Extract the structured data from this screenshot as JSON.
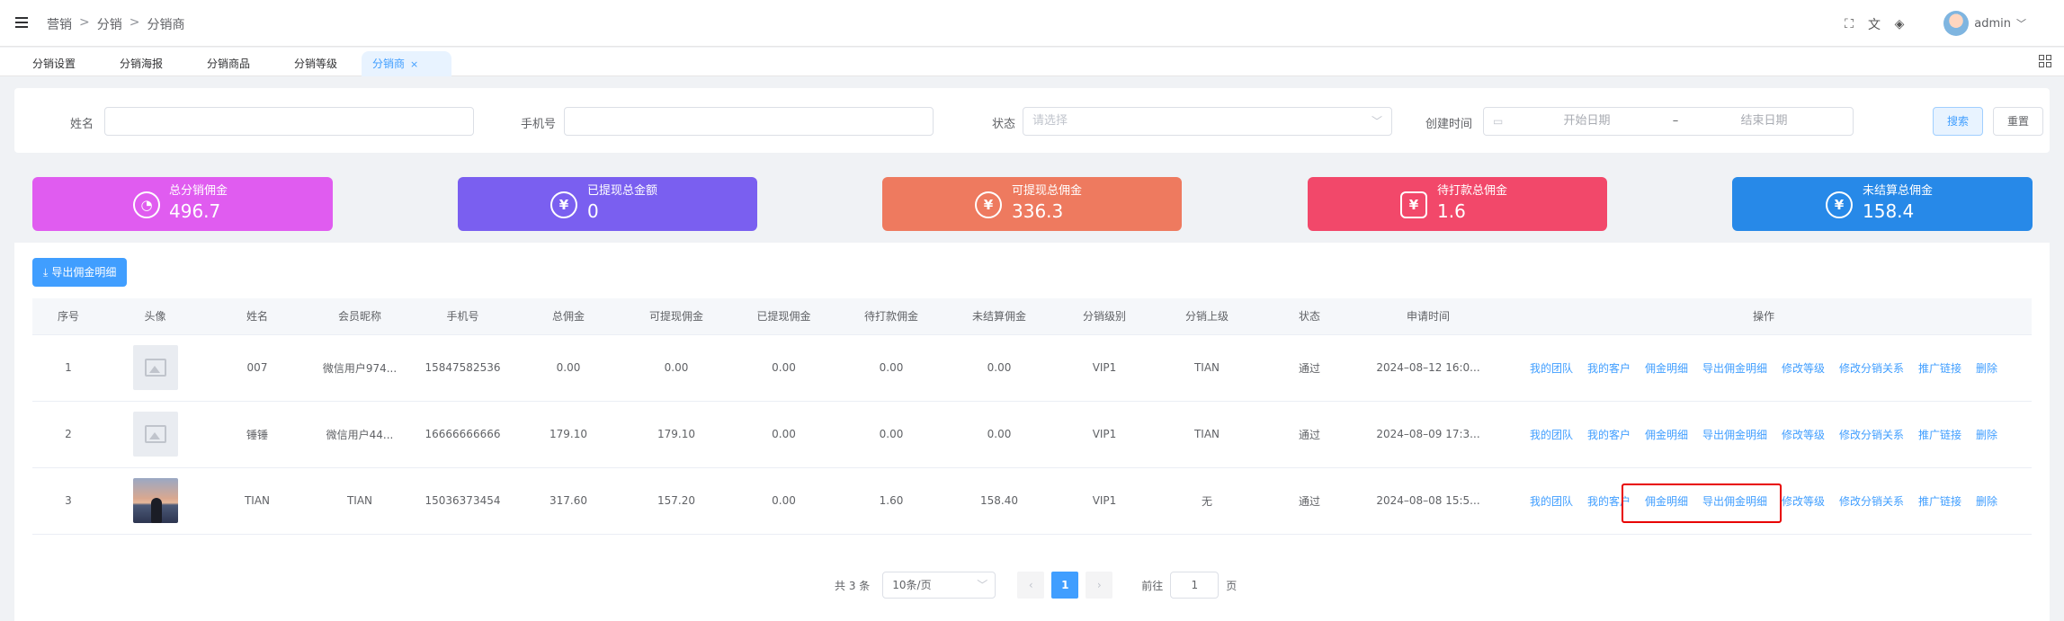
{
  "breadcrumb": {
    "items": [
      "营销",
      "分销",
      "分销商"
    ],
    "sep": ">"
  },
  "header": {
    "username": "admin"
  },
  "tabs": [
    {
      "label": "分销设置"
    },
    {
      "label": "分销海报"
    },
    {
      "label": "分销商品"
    },
    {
      "label": "分销等级"
    },
    {
      "label": "分销商",
      "active": true,
      "close": "×"
    }
  ],
  "search": {
    "name_label": "姓名",
    "name_value": "",
    "phone_label": "手机号",
    "phone_value": "",
    "status_label": "状态",
    "status_placeholder": "请选择",
    "created_label": "创建时间",
    "start_placeholder": "开始日期",
    "range_sep": "–",
    "end_placeholder": "结束日期",
    "search_button": "搜索",
    "reset_button": "重置"
  },
  "stats": [
    {
      "title": "总分销佣金",
      "value": "496.7",
      "color": "#e05cf0",
      "icon": "pie-chart-icon",
      "glyph": "◔"
    },
    {
      "title": "已提现总金额",
      "value": "0",
      "color": "#7a5ff0",
      "icon": "yen-icon",
      "glyph": "¥"
    },
    {
      "title": "可提现总佣金",
      "value": "336.3",
      "color": "#ee7a5f",
      "icon": "yen-icon",
      "glyph": "¥"
    },
    {
      "title": "待打款总佣金",
      "value": "1.6",
      "color": "#f2486a",
      "icon": "pending-money-icon",
      "glyph": "¥"
    },
    {
      "title": "未结算总佣金",
      "value": "158.4",
      "color": "#2789e8",
      "icon": "refresh-yen-icon",
      "glyph": "¥"
    }
  ],
  "export_button": "导出佣金明细",
  "table": {
    "headers": [
      "序号",
      "头像",
      "姓名",
      "会员昵称",
      "手机号",
      "总佣金",
      "可提现佣金",
      "已提现佣金",
      "待打款佣金",
      "未结算佣金",
      "分销级别",
      "分销上级",
      "状态",
      "申请时间",
      "操作"
    ],
    "rows": [
      {
        "idx": "1",
        "avatar": "placeholder",
        "name": "007",
        "nickname": "微信用户974...",
        "phone": "15847582536",
        "total": "0.00",
        "withdrawable": "0.00",
        "withdrawn": "0.00",
        "pending": "0.00",
        "unsettled": "0.00",
        "level": "VIP1",
        "parent": "TIAN",
        "status": "通过",
        "applied": "2024–08–12 16:0..."
      },
      {
        "idx": "2",
        "avatar": "placeholder",
        "name": "锤锤",
        "nickname": "微信用户44...",
        "phone": "16666666666",
        "total": "179.10",
        "withdrawable": "179.10",
        "withdrawn": "0.00",
        "pending": "0.00",
        "unsettled": "0.00",
        "level": "VIP1",
        "parent": "TIAN",
        "status": "通过",
        "applied": "2024–08–09 17:3..."
      },
      {
        "idx": "3",
        "avatar": "photo",
        "name": "TIAN",
        "nickname": "TIAN",
        "phone": "15036373454",
        "total": "317.60",
        "withdrawable": "157.20",
        "withdrawn": "0.00",
        "pending": "1.60",
        "unsettled": "158.40",
        "level": "VIP1",
        "parent": "无",
        "status": "通过",
        "applied": "2024–08–08 15:5..."
      }
    ],
    "actions": [
      "我的团队",
      "我的客户",
      "佣金明细",
      "导出佣金明细",
      "修改等级",
      "修改分销关系",
      "推广链接",
      "删除"
    ]
  },
  "pagination": {
    "total": "共 3 条",
    "page_size": "10条/页",
    "prev": "‹",
    "current": "1",
    "next": "›",
    "goto_label": "前往",
    "goto_value": "1",
    "page_unit": "页"
  }
}
